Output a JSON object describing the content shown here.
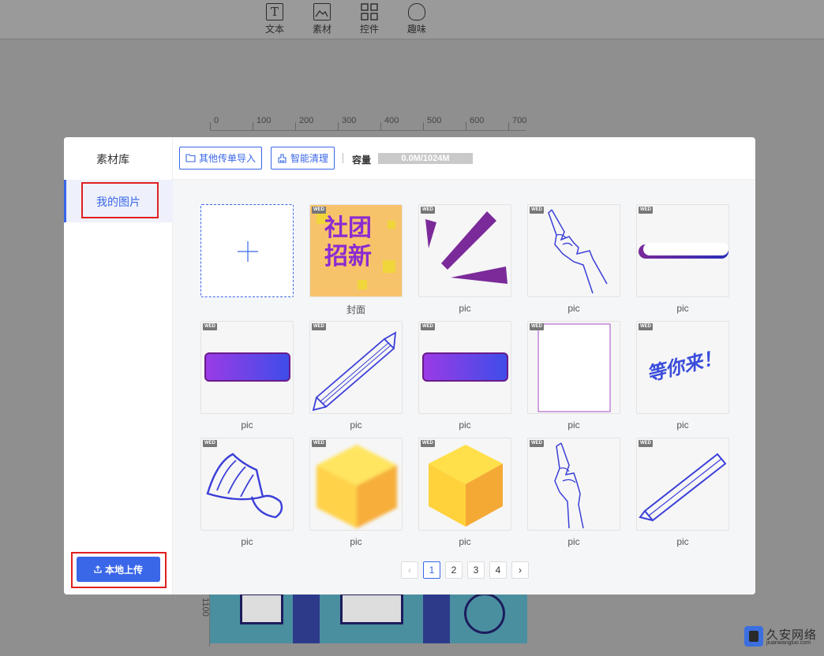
{
  "toolbar": {
    "items": [
      {
        "label": "文本",
        "icon": "text-icon"
      },
      {
        "label": "素材",
        "icon": "image-icon"
      },
      {
        "label": "控件",
        "icon": "grid-icon"
      },
      {
        "label": "趣味",
        "icon": "bulb-icon"
      }
    ]
  },
  "ruler": {
    "ticks": [
      "0",
      "100",
      "200",
      "300",
      "400",
      "500",
      "600",
      "700"
    ],
    "vertical_label": "1100"
  },
  "modal": {
    "sidebar": {
      "title": "素材库",
      "items": [
        {
          "label": "我的图片",
          "active": true
        }
      ],
      "upload_label": "本地上传"
    },
    "header": {
      "import_label": "其他传单导入",
      "clean_label": "智能清理",
      "capacity_label": "容量",
      "capacity_value": "0.0M/1024M"
    },
    "grid": {
      "badge": "WED",
      "items": [
        {
          "caption": "",
          "art": "add"
        },
        {
          "caption": "封面",
          "art": "cover",
          "cover_text": [
            "社",
            "团",
            "招",
            "新"
          ]
        },
        {
          "caption": "pic",
          "art": "shards"
        },
        {
          "caption": "pic",
          "art": "hand"
        },
        {
          "caption": "pic",
          "art": "slim-bar"
        },
        {
          "caption": "pic",
          "art": "gradient-bar"
        },
        {
          "caption": "pic",
          "art": "pencil"
        },
        {
          "caption": "pic",
          "art": "gradient-bar"
        },
        {
          "caption": "pic",
          "art": "frame"
        },
        {
          "caption": "pic",
          "art": "script",
          "script_text": "等你来！"
        },
        {
          "caption": "pic",
          "art": "shuttlecock"
        },
        {
          "caption": "pic",
          "art": "cube-blur"
        },
        {
          "caption": "pic",
          "art": "cube"
        },
        {
          "caption": "pic",
          "art": "hand"
        },
        {
          "caption": "pic",
          "art": "pencil"
        }
      ]
    },
    "pagination": {
      "pages": [
        "1",
        "2",
        "3",
        "4"
      ],
      "current": "1",
      "prev": "‹",
      "next": "›"
    }
  },
  "watermark": {
    "title": "久安网络",
    "sub": "jiuanwangluo.com"
  },
  "colors": {
    "accent": "#3a66e8",
    "highlight": "#e02020",
    "purple": "#7b2a9a",
    "blue_line": "#3b3fd8",
    "cube": "#f7b733"
  }
}
